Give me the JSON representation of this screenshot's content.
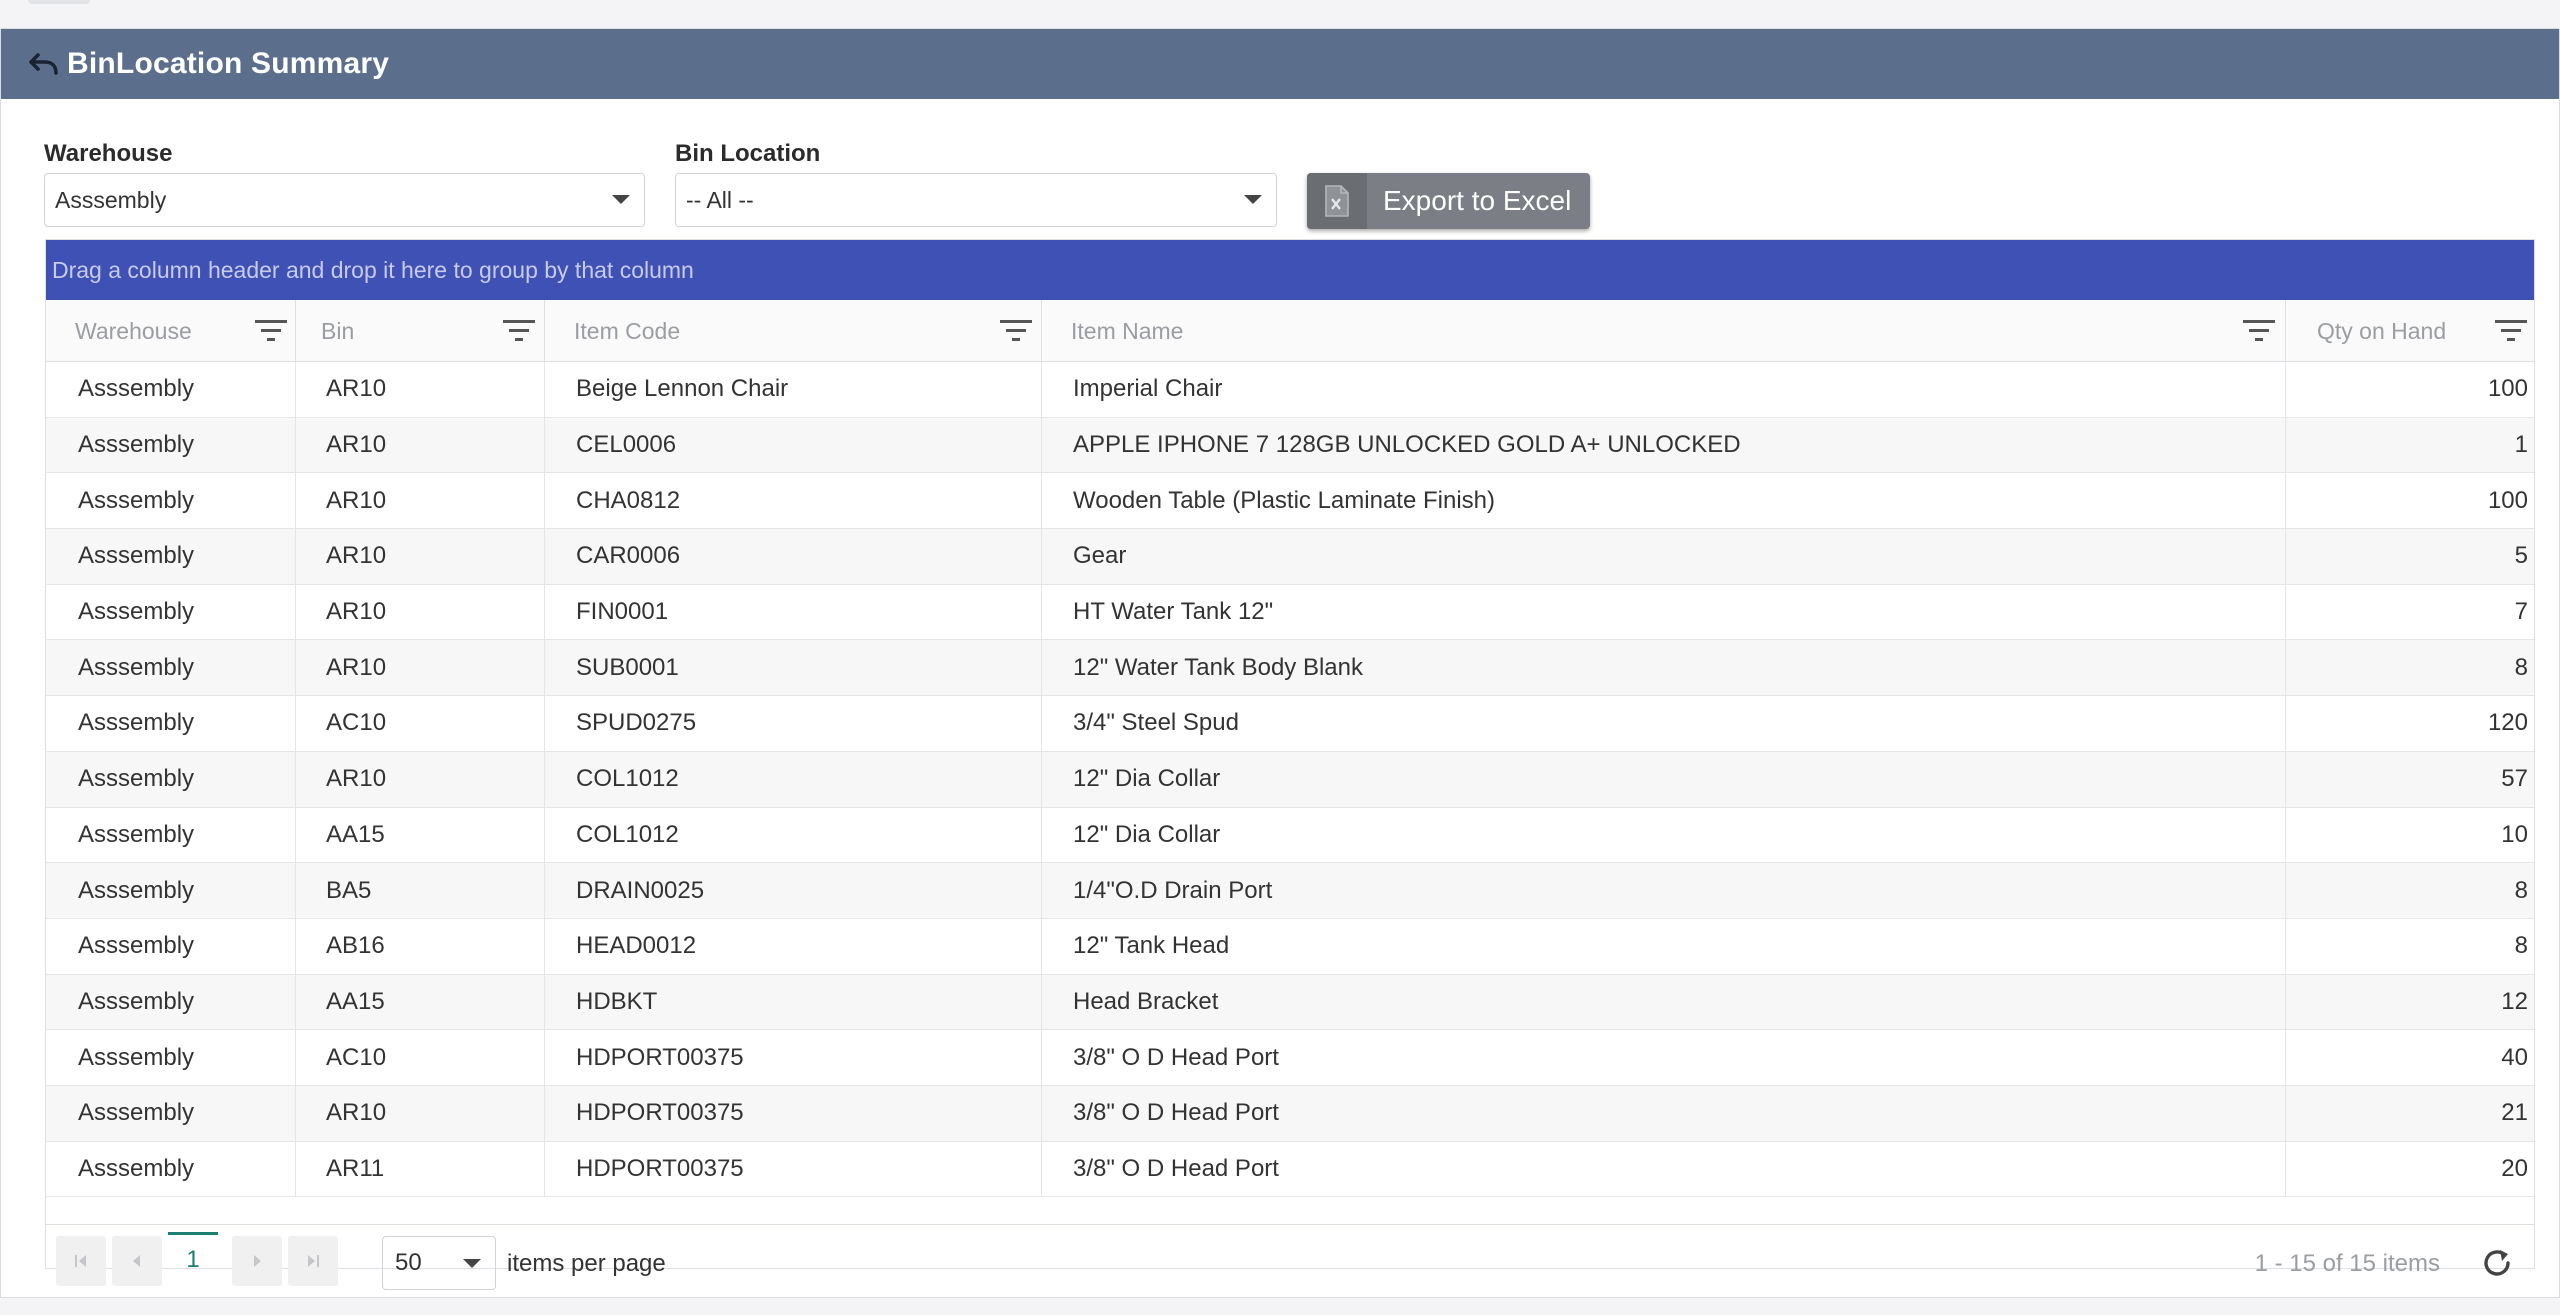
{
  "header": {
    "title": "BinLocation Summary",
    "bg_color": "#5b6f8c"
  },
  "filters": {
    "warehouse_label": "Warehouse",
    "warehouse_value": "Asssembly",
    "bin_label": "Bin Location",
    "bin_value": "-- All --"
  },
  "export_button": {
    "label": "Export to Excel",
    "icon": "excel-icon"
  },
  "grid": {
    "group_bar_text": "Drag a column header and drop it here to group by that column",
    "group_bar_color": "#3f51b5",
    "columns": [
      "Warehouse",
      "Bin",
      "Item Code",
      "Item Name",
      "Qty on Hand"
    ],
    "rows": [
      [
        "Asssembly",
        "AR10",
        "Beige Lennon Chair",
        "Imperial Chair",
        "100"
      ],
      [
        "Asssembly",
        "AR10",
        "CEL0006",
        "APPLE IPHONE 7 128GB UNLOCKED GOLD A+ UNLOCKED",
        "1"
      ],
      [
        "Asssembly",
        "AR10",
        "CHA0812",
        "Wooden Table (Plastic Laminate Finish)",
        "100"
      ],
      [
        "Asssembly",
        "AR10",
        "CAR0006",
        "Gear",
        "5"
      ],
      [
        "Asssembly",
        "AR10",
        "FIN0001",
        "HT Water Tank 12\"",
        "7"
      ],
      [
        "Asssembly",
        "AR10",
        "SUB0001",
        "12\" Water Tank Body Blank",
        "8"
      ],
      [
        "Asssembly",
        "AC10",
        "SPUD0275",
        "3/4\" Steel Spud",
        "120"
      ],
      [
        "Asssembly",
        "AR10",
        "COL1012",
        "12\" Dia Collar",
        "57"
      ],
      [
        "Asssembly",
        "AA15",
        "COL1012",
        "12\" Dia Collar",
        "10"
      ],
      [
        "Asssembly",
        "BA5",
        "DRAIN0025",
        "1/4\"O.D Drain Port",
        "8"
      ],
      [
        "Asssembly",
        "AB16",
        "HEAD0012",
        "12\" Tank Head",
        "8"
      ],
      [
        "Asssembly",
        "AA15",
        "HDBKT",
        "Head Bracket",
        "12"
      ],
      [
        "Asssembly",
        "AC10",
        "HDPORT00375",
        "3/8\" O D Head Port",
        "40"
      ],
      [
        "Asssembly",
        "AR10",
        "HDPORT00375",
        "3/8\" O D Head Port",
        "21"
      ],
      [
        "Asssembly",
        "AR11",
        "HDPORT00375",
        "3/8\" O D Head Port",
        "20"
      ]
    ]
  },
  "pager": {
    "current_page": "1",
    "page_size": "50",
    "per_page_label": "items per page",
    "item_count": "1 - 15 of 15 items",
    "accent_color": "#1a7f6f"
  }
}
